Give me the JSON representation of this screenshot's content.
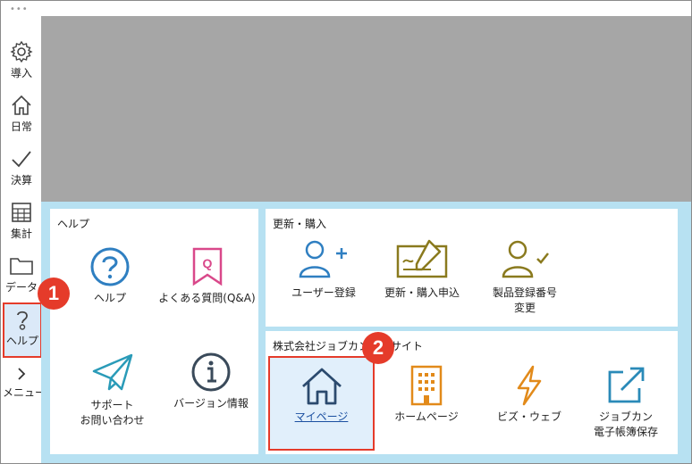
{
  "window": {
    "menu_dots": "•••"
  },
  "sidebar": {
    "items": [
      {
        "label": "導入",
        "icon": "gear-icon"
      },
      {
        "label": "日常",
        "icon": "home-icon"
      },
      {
        "label": "決算",
        "icon": "checkmark-icon"
      },
      {
        "label": "集計",
        "icon": "table-icon"
      },
      {
        "label": "データ",
        "icon": "folder-icon"
      },
      {
        "label": "ヘルプ",
        "icon": "help-icon"
      },
      {
        "label": "メニュー",
        "icon": "chevron-right-icon"
      }
    ]
  },
  "help_panel": {
    "title": "ヘルプ",
    "items": [
      {
        "label": "ヘルプ",
        "icon": "help-circle-icon"
      },
      {
        "label": "よくある質問(Q&A)",
        "icon": "faq-bookmark-icon"
      },
      {
        "label": "サポート\nお問い合わせ",
        "icon": "paper-plane-icon"
      },
      {
        "label": "バージョン情報",
        "icon": "info-icon"
      }
    ]
  },
  "renewal_panel": {
    "title": "更新・購入",
    "items": [
      {
        "label": "ユーザー登録",
        "icon": "user-add-icon"
      },
      {
        "label": "更新・購入申込",
        "icon": "signature-icon"
      },
      {
        "label": "製品登録番号\n変更",
        "icon": "user-check-icon"
      }
    ]
  },
  "site_panel": {
    "title": "株式会社ジョブカン会計サイト",
    "items": [
      {
        "label": "マイページ",
        "icon": "home-icon"
      },
      {
        "label": "ホームページ",
        "icon": "building-icon"
      },
      {
        "label": "ビズ・ウェブ",
        "icon": "lightning-icon"
      },
      {
        "label": "ジョブカン\n電子帳簿保存",
        "icon": "external-link-icon"
      }
    ]
  },
  "badges": [
    "1",
    "2"
  ],
  "colors": {
    "accent_red": "#e53b2a",
    "icon_blue": "#2f7fc1",
    "icon_navy": "#2b4a6e",
    "icon_olive": "#8a7a1e",
    "icon_orange": "#e28a1a",
    "icon_pink": "#d9488a",
    "panel_bg": "#b7e1f2"
  }
}
